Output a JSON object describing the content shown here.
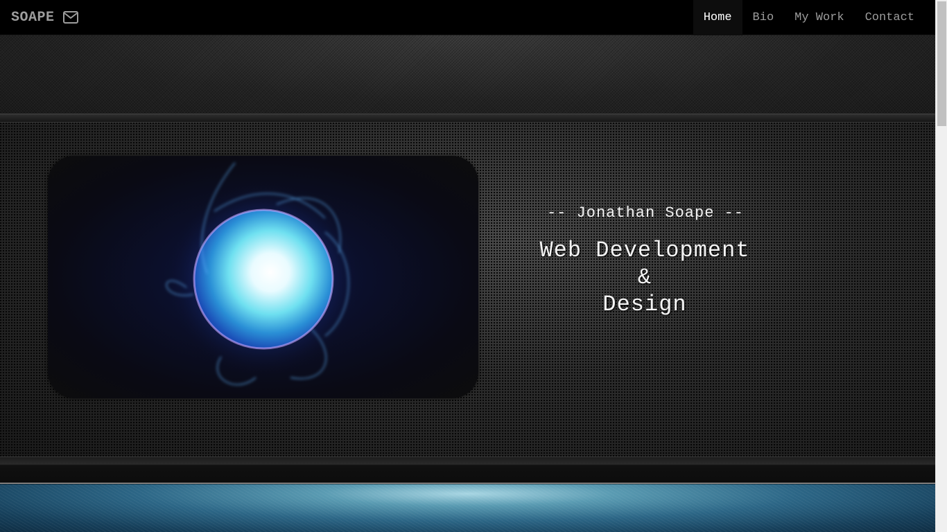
{
  "navbar": {
    "brand": "SOAPE",
    "brand_icon": "envelope-icon",
    "items": [
      {
        "label": "Home",
        "active": true
      },
      {
        "label": "Bio",
        "active": false
      },
      {
        "label": "My Work",
        "active": false
      },
      {
        "label": "Contact",
        "active": false
      }
    ]
  },
  "hero": {
    "image_subject": "glowing blue energy orb",
    "subtitle": "-- Jonathan Soape --",
    "headline_line1": "Web Development",
    "headline_line2": "&",
    "headline_line3": "Design"
  },
  "colors": {
    "navbar_bg": "#000000",
    "nav_text": "#9d9d9d",
    "nav_active_text": "#ffffff",
    "orb_glow": "#4aa8ff",
    "blue_band": "#2c6686"
  }
}
